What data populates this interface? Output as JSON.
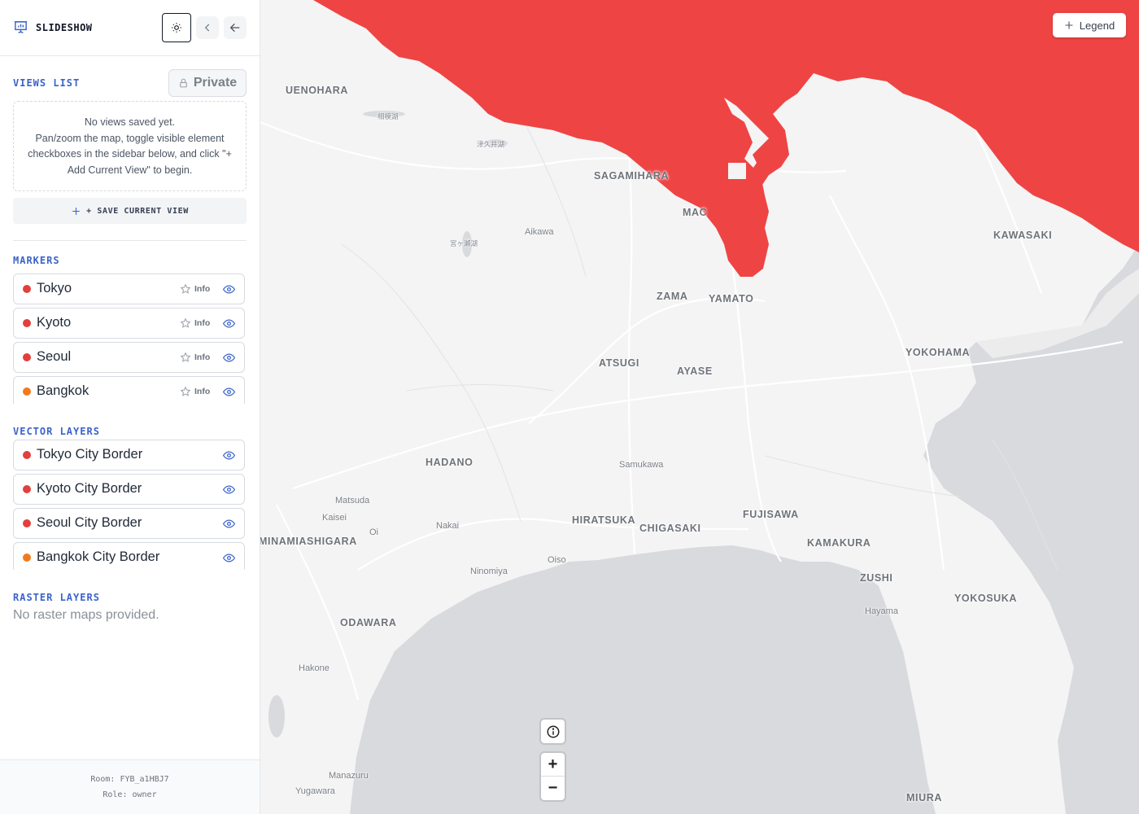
{
  "app": {
    "title": "SLIDESHOW"
  },
  "views": {
    "title": "VIEWS LIST",
    "privacy_label": "Private",
    "empty_line1": "No views saved yet.",
    "empty_line2": "Pan/zoom the map, toggle visible element checkboxes in the sidebar below, and click \"+ Add Current View\" to begin.",
    "save_label": "+ SAVE CURRENT VIEW"
  },
  "markers": {
    "title": "MARKERS",
    "items": [
      {
        "label": "Tokyo",
        "color": "#e0403e",
        "info": "Info"
      },
      {
        "label": "Kyoto",
        "color": "#e0403e",
        "info": "Info"
      },
      {
        "label": "Seoul",
        "color": "#e0403e",
        "info": "Info"
      },
      {
        "label": "Bangkok",
        "color": "#f07b1f",
        "info": "Info"
      }
    ]
  },
  "vector_layers": {
    "title": "VECTOR LAYERS",
    "items": [
      {
        "label": "Tokyo City Border",
        "color": "#e0403e"
      },
      {
        "label": "Kyoto City Border",
        "color": "#e0403e"
      },
      {
        "label": "Seoul City Border",
        "color": "#e0403e"
      },
      {
        "label": "Bangkok City Border",
        "color": "#f07b1f"
      }
    ]
  },
  "raster_layers": {
    "title": "RASTER LAYERS",
    "empty": "No raster maps provided."
  },
  "footer": {
    "room": "Room: FYB_a1HBJ7",
    "role": "Role: owner"
  },
  "map": {
    "legend_label": "Legend",
    "zoom_in_label": "+",
    "zoom_out_label": "−",
    "border_color": "#ef4444",
    "land_color": "#f4f4f4",
    "sea_color": "#d8dadd",
    "places": {
      "uenohara": "UENOHARA",
      "sagamiko": "相模湖",
      "tsukui": "津久井湖",
      "miyagase": "宮ヶ瀬湖",
      "sagamihara": "SAGAMIHARA",
      "machida": "MAC",
      "aikawa": "Aikawa",
      "kawasaki": "KAWASAKI",
      "zama": "ZAMA",
      "yamato": "YAMATO",
      "yokohama": "YOKOHAMA",
      "atsugi": "ATSUGI",
      "ayase": "AYASE",
      "hadano": "HADANO",
      "samukawa": "Samukawa",
      "matsuda": "Matsuda",
      "kaisei": "Kaisei",
      "oi": "Oi",
      "nakai": "Nakai",
      "minamiashigara": "MINAMIASHIGARA",
      "hiratsuka": "HIRATSUKA",
      "chigasaki": "CHIGASAKI",
      "fujisawa": "FUJISAWA",
      "kamakura": "KAMAKURA",
      "oiso": "Oiso",
      "ninomiya": "Ninomiya",
      "zushi": "ZUSHI",
      "hayama": "Hayama",
      "yokosuka": "YOKOSUKA",
      "odawara": "ODAWARA",
      "hakone": "Hakone",
      "manazuru": "Manazuru",
      "yugawara": "Yugawara",
      "miura": "MIURA"
    }
  }
}
